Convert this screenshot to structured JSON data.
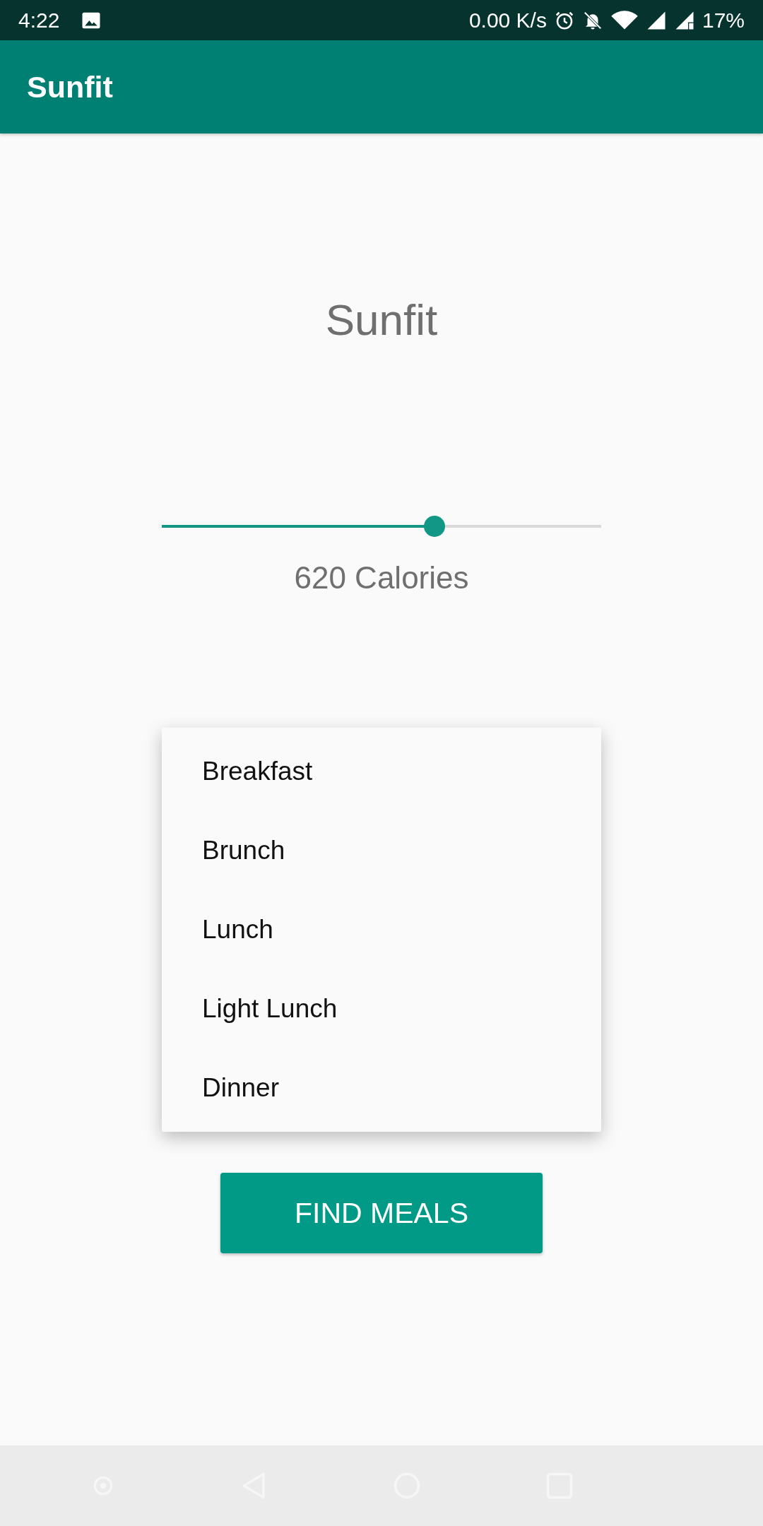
{
  "status_bar": {
    "time": "4:22",
    "network_speed": "0.00 K/s",
    "battery": "17%"
  },
  "app_bar": {
    "title": "Sunfit"
  },
  "heading": "Sunfit",
  "calorie_slider": {
    "level": 0.62
  },
  "calories_label": "620 Calories",
  "meal_menu": {
    "items": [
      {
        "label": "Breakfast"
      },
      {
        "label": "Brunch"
      },
      {
        "label": "Lunch"
      },
      {
        "label": "Light Lunch"
      },
      {
        "label": "Dinner"
      }
    ]
  },
  "find_button": "FIND MEALS"
}
